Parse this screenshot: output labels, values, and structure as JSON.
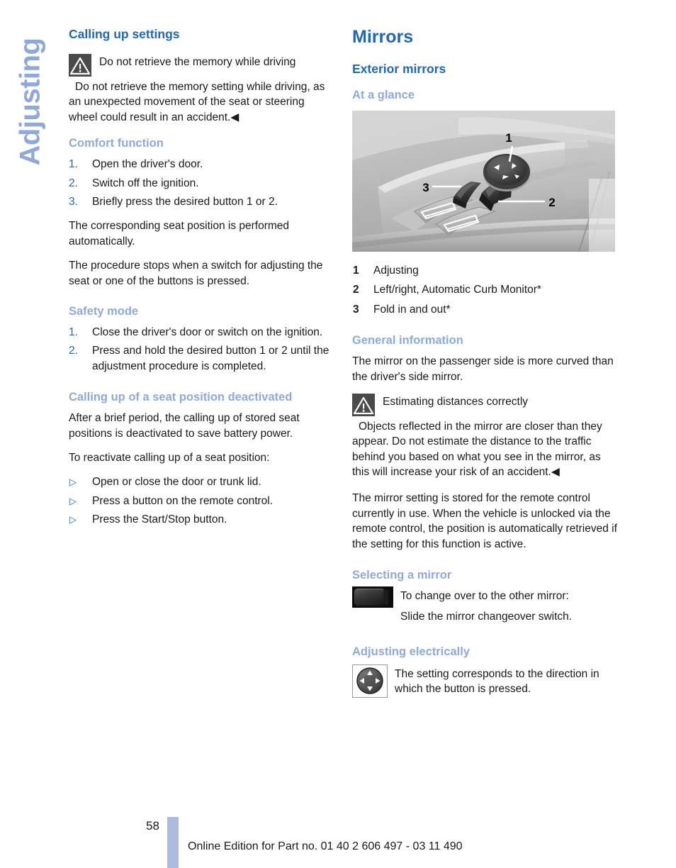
{
  "chapter_tab": {
    "label": "Adjusting"
  },
  "left_column": {
    "heading": "Calling up settings",
    "warning": {
      "icon": "warning-triangle-icon",
      "title": "Do not retrieve the memory while driving",
      "body": "Do not retrieve the memory setting while driving, as an unexpected movement of the seat or steering wheel could result in an accident.◀"
    },
    "comfort": {
      "heading": "Comfort function",
      "steps": [
        {
          "num": "1.",
          "text": "Open the driver's door."
        },
        {
          "num": "2.",
          "text": "Switch off the ignition."
        },
        {
          "num": "3.",
          "text": "Briefly press the desired button 1 or 2."
        }
      ],
      "para1": "The corresponding seat position is performed automatically.",
      "para2": "The procedure stops when a switch for adjusting the seat or one of the buttons is pressed."
    },
    "safety_mode": {
      "heading": "Safety mode",
      "steps": [
        {
          "num": "1.",
          "text": "Close the driver's door or switch on the ignition."
        },
        {
          "num": "2.",
          "text": "Press and hold the desired button 1 or 2 until the adjustment procedure is completed."
        }
      ]
    },
    "deactivated": {
      "heading": "Calling up of a seat position deactivated",
      "para1": "After a brief period, the calling up of stored seat positions is deactivated to save battery power.",
      "para2": "To reactivate calling up of a seat position:",
      "bullets": [
        "Open or close the door or trunk lid.",
        "Press a button on the remote control.",
        "Press the Start/Stop button."
      ]
    }
  },
  "right_column": {
    "heading": "Mirrors",
    "section_heading": "Exterior mirrors",
    "at_a_glance": {
      "heading": "At a glance",
      "figure_name": "door-control-panel-photo",
      "figure_callouts": [
        "1",
        "2",
        "3"
      ],
      "legend": [
        {
          "num": "1",
          "text": "Adjusting"
        },
        {
          "num": "2",
          "text": "Left/right, Automatic Curb Monitor*"
        },
        {
          "num": "3",
          "text": "Fold in and out*"
        }
      ]
    },
    "general_information": {
      "heading": "General information",
      "para1": "The mirror on the passenger side is more curved than the driver's side mirror.",
      "warning": {
        "icon": "warning-triangle-icon",
        "title": "Estimating distances correctly",
        "body": "Objects reflected in the mirror are closer than they appear. Do not estimate the distance to the traffic behind you based on what you see in the mirror, as this will increase your risk of an accident.◀"
      },
      "para2": "The mirror setting is stored for the remote control currently in use. When the vehicle is unlocked via the remote control, the position is automatically retrieved if the setting for this function is active."
    },
    "selecting_mirror": {
      "heading": "Selecting a mirror",
      "icon": "mirror-changeover-switch-icon",
      "line1": "To change over to the other mirror:",
      "line2": "Slide the mirror changeover switch."
    },
    "adjusting_electrically": {
      "heading": "Adjusting electrically",
      "icon": "four-way-joystick-icon",
      "text": "The setting corresponds to the direction in which the button is pressed."
    }
  },
  "footer": {
    "page_number": "58",
    "text": "Online Edition for Part no. 01 40 2 606 497 - 03 11 490"
  },
  "colors": {
    "heading_primary": "#1f69b4",
    "heading_secondary": "#8faada",
    "body_text": "#1a1a1a",
    "warning_icon_bg": "#4a4a4a",
    "footer_bar": "#aebbdf"
  }
}
